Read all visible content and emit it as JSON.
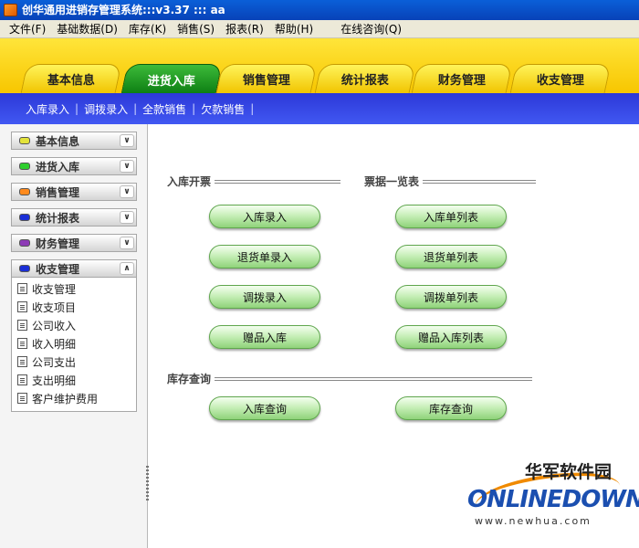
{
  "window": {
    "title": "创华通用进销存管理系统:::v3.37  :::  aa"
  },
  "menu": [
    "文件(F)",
    "基础数据(D)",
    "库存(K)",
    "销售(S)",
    "报表(R)",
    "帮助(H)",
    "在线咨询(Q)"
  ],
  "tabs": [
    {
      "label": "基本信息",
      "active": false
    },
    {
      "label": "进货入库",
      "active": true
    },
    {
      "label": "销售管理",
      "active": false
    },
    {
      "label": "统计报表",
      "active": false
    },
    {
      "label": "财务管理",
      "active": false
    },
    {
      "label": "收支管理",
      "active": false
    }
  ],
  "subnav": [
    "入库录入",
    "调拨录入",
    "全款销售",
    "欠款销售"
  ],
  "sidebar": {
    "groups": [
      {
        "label": "基本信息",
        "color": "#e3e33a",
        "chevron": "expand"
      },
      {
        "label": "进货入库",
        "color": "#2ecf2e",
        "chevron": "expand"
      },
      {
        "label": "销售管理",
        "color": "#ff8a1c",
        "chevron": "expand"
      },
      {
        "label": "统计报表",
        "color": "#1b2fd6",
        "chevron": "expand"
      },
      {
        "label": "财务管理",
        "color": "#8d3bb6",
        "chevron": "expand"
      },
      {
        "label": "收支管理",
        "color": "#1b2fd6",
        "chevron": "collapse"
      }
    ],
    "open_items": [
      "收支管理",
      "收支项目",
      "公司收入",
      "收入明细",
      "公司支出",
      "支出明细",
      "客户维护费用"
    ]
  },
  "main": {
    "sections": {
      "invoice": "入库开票",
      "lists": "票据一览表",
      "query": "库存查询"
    },
    "buttons": {
      "invoice": [
        "入库录入",
        "退货单录入",
        "调拨录入",
        "赠品入库"
      ],
      "lists": [
        "入库单列表",
        "退货单列表",
        "调拨单列表",
        "赠品入库列表"
      ],
      "query": [
        "入库查询",
        "库存查询"
      ]
    }
  },
  "watermark": {
    "cn": "华军软件园",
    "en": "ONLINEDOWN",
    "url": "www.newhua.com"
  }
}
